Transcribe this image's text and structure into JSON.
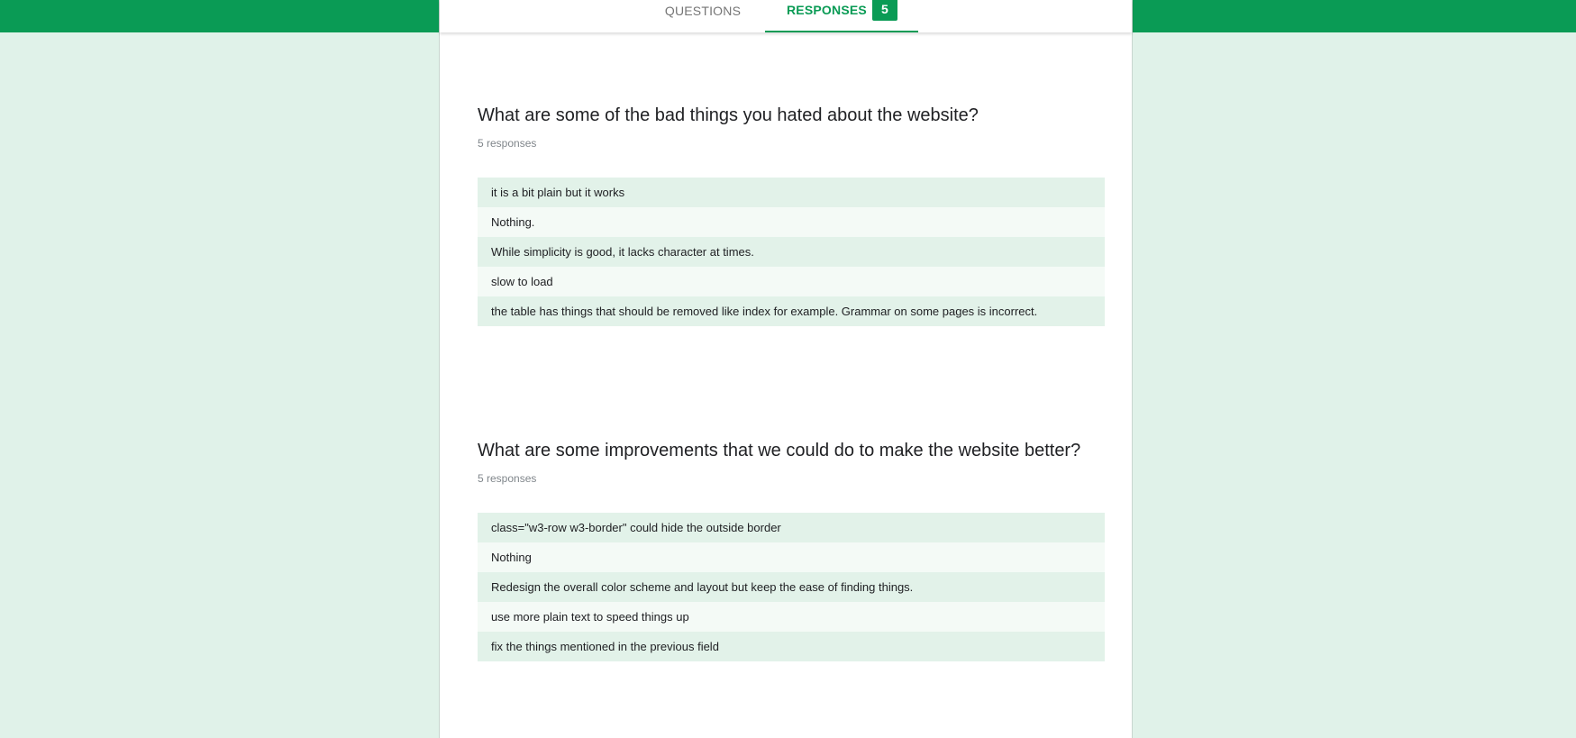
{
  "tabs": {
    "questions_label": "QUESTIONS",
    "responses_label": "RESPONSES",
    "responses_count": "5"
  },
  "questions": [
    {
      "title": "What are some of the bad things you hated about the website?",
      "count_label": "5 responses",
      "answers": [
        "it is a bit plain but it works",
        "Nothing.",
        "While simplicity is good, it lacks character at times.",
        "slow to load",
        "the table has things that should be removed like index for example. Grammar on some pages is incorrect."
      ]
    },
    {
      "title": "What are some improvements that we could do to make the website better?",
      "count_label": "5 responses",
      "answers": [
        "class=\"w3-row w3-border\" could hide the outside border",
        "Nothing",
        "Redesign the overall color scheme and layout but keep the ease of finding things.",
        "use more plain text to speed things up",
        "fix the things mentioned in the previous field"
      ]
    }
  ],
  "colors": {
    "accent": "#0a9b55",
    "background": "#e0f2e9",
    "row_odd": "#e2f2e9",
    "row_even": "#f4faf6"
  }
}
